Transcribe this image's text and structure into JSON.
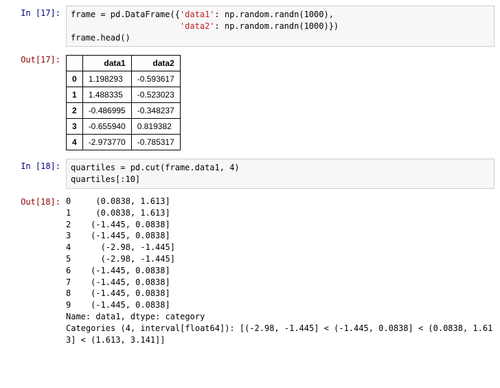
{
  "cells": {
    "in17_prompt": "In  [17]:",
    "out17_prompt": "Out[17]:",
    "in18_prompt": "In  [18]:",
    "out18_prompt": "Out[18]:"
  },
  "code17": {
    "pre1": "frame = pd.DataFrame({",
    "str1": "'data1'",
    "mid1": ": np.random.randn(1000),",
    "pad2": "                      ",
    "str2": "'data2'",
    "mid2": ": np.random.randn(1000)})",
    "line3": "frame.head()"
  },
  "table17": {
    "columns": [
      "",
      "data1",
      "data2"
    ],
    "rows": [
      {
        "idx": "0",
        "data1": "1.198293",
        "data2": "-0.593617"
      },
      {
        "idx": "1",
        "data1": "1.488335",
        "data2": "-0.523023"
      },
      {
        "idx": "2",
        "data1": "-0.486995",
        "data2": "-0.348237"
      },
      {
        "idx": "3",
        "data1": "-0.655940",
        "data2": "0.819382"
      },
      {
        "idx": "4",
        "data1": "-2.973770",
        "data2": "-0.785317"
      }
    ]
  },
  "code18": {
    "line1": "quartiles = pd.cut(frame.data1, 4)",
    "line2": "quartiles[:10]"
  },
  "out18_text": "0     (0.0838, 1.613]\n1     (0.0838, 1.613]\n2    (-1.445, 0.0838]\n3    (-1.445, 0.0838]\n4      (-2.98, -1.445]\n5      (-2.98, -1.445]\n6    (-1.445, 0.0838]\n7    (-1.445, 0.0838]\n8    (-1.445, 0.0838]\n9    (-1.445, 0.0838]\nName: data1, dtype: category\nCategories (4, interval[float64]): [(-2.98, -1.445] < (-1.445, 0.0838] < (0.0838, 1.61\n3] < (1.613, 3.141]]"
}
